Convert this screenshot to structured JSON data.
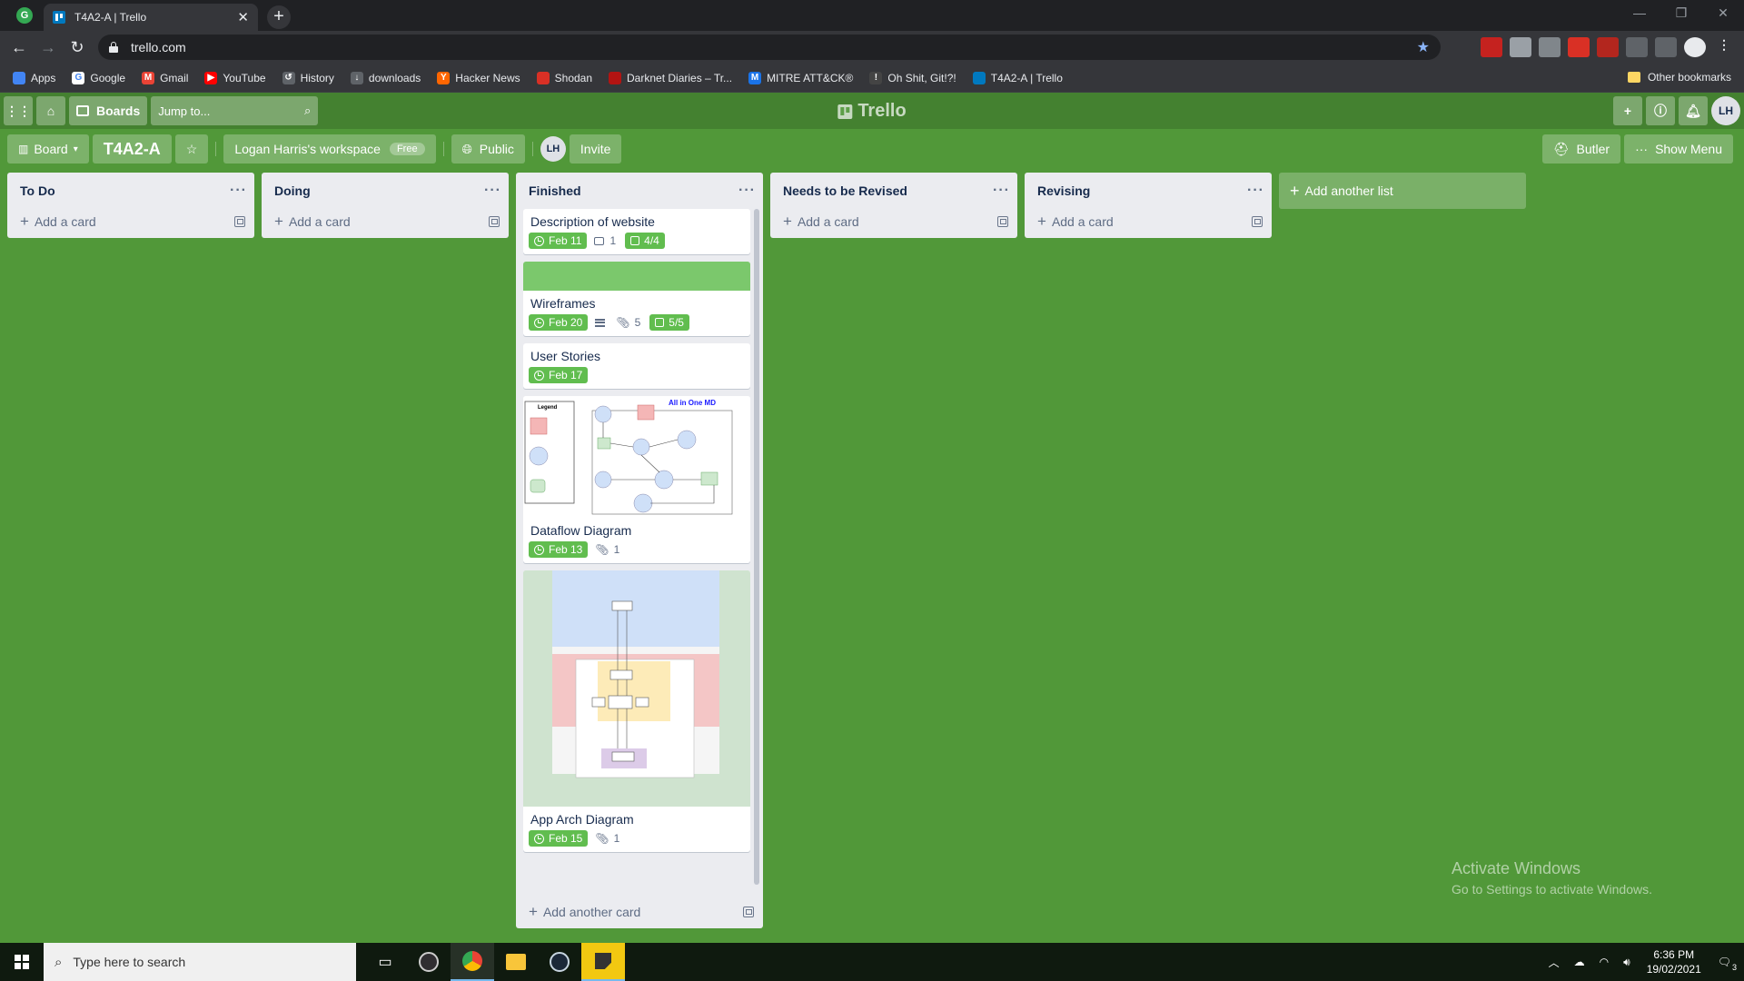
{
  "browser": {
    "tab_title": "T4A2-A | Trello",
    "tab_close": "✕",
    "new_tab": "+",
    "url": "trello.com",
    "window_controls": [
      "—",
      "❐",
      "✕"
    ]
  },
  "bookmarks": [
    {
      "label": "Apps",
      "icon": "apps-grid-icon",
      "color": "#4285f4"
    },
    {
      "label": "Google",
      "icon": "google-icon",
      "color": "#ffffff"
    },
    {
      "label": "Gmail",
      "icon": "gmail-icon",
      "color": "#ea4335"
    },
    {
      "label": "YouTube",
      "icon": "youtube-icon",
      "color": "#ff0000"
    },
    {
      "label": "History",
      "icon": "history-icon",
      "color": "#5f6368"
    },
    {
      "label": "downloads",
      "icon": "download-icon",
      "color": "#5f6368"
    },
    {
      "label": "Hacker News",
      "icon": "hacker-news-icon",
      "color": "#ff6600"
    },
    {
      "label": "Shodan",
      "icon": "shodan-icon",
      "color": "#d93025"
    },
    {
      "label": "Darknet Diaries – Tr...",
      "icon": "darknet-diaries-icon",
      "color": "#b31412"
    },
    {
      "label": "MITRE ATT&CK®",
      "icon": "mitre-icon",
      "color": "#1a73e8"
    },
    {
      "label": "Oh Shit, Git!?!",
      "icon": "ohshitgit-icon",
      "color": "#444444"
    },
    {
      "label": "T4A2-A | Trello",
      "icon": "trello-icon",
      "color": "#0079bf"
    }
  ],
  "other_bookmarks": "Other bookmarks",
  "header": {
    "boards_label": "Boards",
    "search_placeholder": "Jump to...",
    "logo": "Trello",
    "avatar": "LH"
  },
  "board": {
    "view_label": "Board",
    "title": "T4A2-A",
    "workspace": "Logan Harris's workspace",
    "workspace_badge": "Free",
    "visibility": "Public",
    "member_avatar": "LH",
    "invite_label": "Invite",
    "butler_label": "Butler",
    "show_menu_label": "Show Menu"
  },
  "lists": [
    {
      "name": "To Do",
      "add_card": "Add a card"
    },
    {
      "name": "Doing",
      "add_card": "Add a card"
    },
    {
      "name": "Finished",
      "add_card": "Add another card"
    },
    {
      "name": "Needs to be Revised",
      "add_card": "Add a card"
    },
    {
      "name": "Revising",
      "add_card": "Add a card"
    }
  ],
  "finished_cards": [
    {
      "title": "Description of website",
      "due": "Feb 11",
      "comments": "1",
      "checklist": "4/4"
    },
    {
      "title": "Wireframes",
      "due": "Feb 20",
      "attachments": "5",
      "checklist": "5/5",
      "cover_color": "#7bc86c"
    },
    {
      "title": "User Stories",
      "due": "Feb 17"
    },
    {
      "title": "Dataflow Diagram",
      "due": "Feb 13",
      "attachments": "1",
      "cover_text": [
        "Legend",
        "All in One MD"
      ]
    },
    {
      "title": "App Arch Diagram",
      "due": "Feb 15",
      "attachments": "1"
    }
  ],
  "add_another_list": "Add another list",
  "list_menu": "···",
  "watermark": {
    "line1": "Activate Windows",
    "line2": "Go to Settings to activate Windows."
  },
  "taskbar": {
    "search_placeholder": "Type here to search",
    "time": "6:36 PM",
    "date": "19/02/2021",
    "notification_count": "3"
  },
  "colors": {
    "board_bg": "#519839",
    "due_complete": "#61bd4f",
    "cover_green": "#7bc86c"
  }
}
